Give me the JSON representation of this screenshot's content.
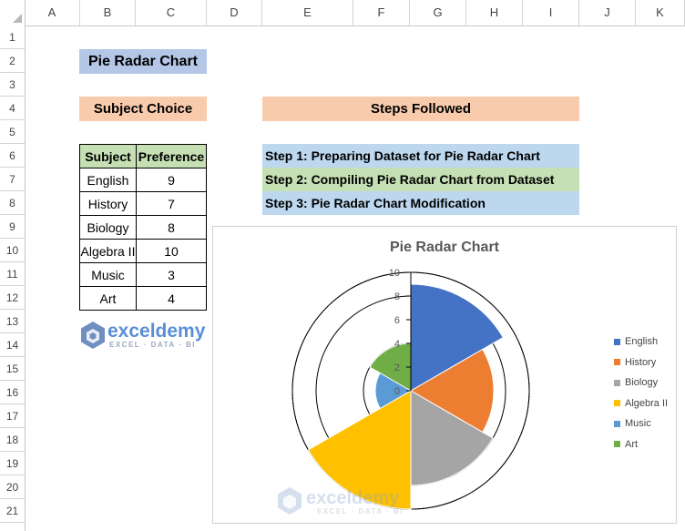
{
  "sheet": {
    "columns": [
      "A",
      "B",
      "C",
      "D",
      "E",
      "F",
      "G",
      "H",
      "I",
      "J",
      "K"
    ],
    "rows": [
      "1",
      "2",
      "3",
      "4",
      "5",
      "6",
      "7",
      "8",
      "9",
      "10",
      "11",
      "12",
      "13",
      "14",
      "15",
      "16",
      "17",
      "18",
      "19",
      "20",
      "21"
    ]
  },
  "title": "Pie Radar Chart",
  "subject_choice": {
    "heading": "Subject Choice",
    "col_subject": "Subject",
    "col_preference": "Preference",
    "rows": [
      {
        "subject": "English",
        "preference": "9"
      },
      {
        "subject": "History",
        "preference": "7"
      },
      {
        "subject": "Biology",
        "preference": "8"
      },
      {
        "subject": "Algebra II",
        "preference": "10"
      },
      {
        "subject": "Music",
        "preference": "3"
      },
      {
        "subject": "Art",
        "preference": "4"
      }
    ]
  },
  "steps": {
    "heading": "Steps Followed",
    "items": [
      {
        "label": "Step 1: Preparing Dataset for Pie Radar Chart",
        "color": "#bdd7ee"
      },
      {
        "label": "Step 2: Compiling Pie Radar Chart from Dataset",
        "color": "#c5e0b4"
      },
      {
        "label": "Step 3: Pie Radar Chart Modification",
        "color": "#bdd7ee"
      }
    ]
  },
  "logo": {
    "name": "exceldemy",
    "tagline": "EXCEL · DATA · BI"
  },
  "chart_data": {
    "type": "pie-radar",
    "title": "Pie Radar Chart",
    "categories": [
      "English",
      "History",
      "Biology",
      "Algebra II",
      "Music",
      "Art"
    ],
    "values": [
      9,
      7,
      8,
      10,
      3,
      4
    ],
    "colors": [
      "#4472c4",
      "#ed7d31",
      "#a5a5a5",
      "#ffc000",
      "#5b9bd5",
      "#70ad47"
    ],
    "axis_ticks": [
      "0",
      "2",
      "4",
      "6",
      "8",
      "10"
    ],
    "rlim": [
      0,
      10
    ],
    "grid": true,
    "legend_position": "right"
  }
}
